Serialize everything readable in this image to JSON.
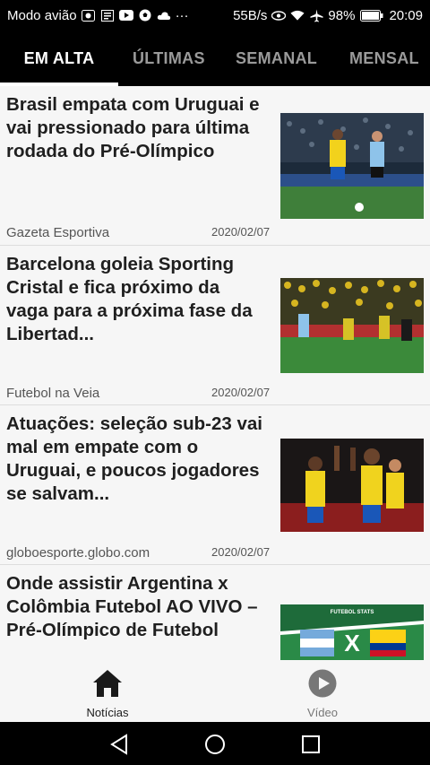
{
  "status_bar": {
    "left_text": "Modo avião",
    "icons_left": [
      "photo-icon",
      "news-icon",
      "youtube-icon",
      "soccer-ball-icon",
      "cloud-icon"
    ],
    "more": "···",
    "speed": "55B/s",
    "icons_right": [
      "eye-icon",
      "wifi-icon",
      "airplane-icon"
    ],
    "battery": "98%",
    "time": "20:09"
  },
  "tabs": [
    {
      "label": "EM ALTA",
      "active": true
    },
    {
      "label": "ÚLTIMAS",
      "active": false
    },
    {
      "label": "SEMANAL",
      "active": false
    },
    {
      "label": "MENSAL",
      "active": false
    }
  ],
  "articles": [
    {
      "title": "Brasil empata com Uruguai e vai pressionado para última rodada do Pré-Olímpico",
      "source": "Gazeta Esportiva",
      "date": "2020/02/07",
      "thumb": "football-match-photo"
    },
    {
      "title": "Barcelona goleia Sporting Cristal e fica próximo da vaga para a próxima fase da Libertad...",
      "source": "Futebol na Veia",
      "date": "2020/02/07",
      "thumb": "football-match-photo"
    },
    {
      "title": "Atuações: seleção sub-23 vai mal em empate com o Uruguai, e poucos jogadores se salvam...",
      "source": "globoesporte.globo.com",
      "date": "2020/02/07",
      "thumb": "players-celebrating-photo"
    },
    {
      "title": "Onde assistir Argentina x Colômbia Futebol AO VIVO – Pré-Olímpico de Futebol",
      "source": "",
      "date": "",
      "thumb": "argentina-vs-colombia-graphic",
      "thumb_text": "FUTEBOL STATS"
    }
  ],
  "bottom_nav": [
    {
      "label": "Notícias",
      "icon": "home-icon",
      "active": true
    },
    {
      "label": "Vídeo",
      "icon": "play-circle-icon",
      "active": false
    }
  ],
  "system_nav": [
    "back-icon",
    "home-circle-icon",
    "recents-icon"
  ],
  "colors": {
    "active_tab": "#ffffff",
    "inactive_tab": "#9a9a9a",
    "feed_bg": "#f6f6f6",
    "title_text": "#1f1f1f"
  }
}
